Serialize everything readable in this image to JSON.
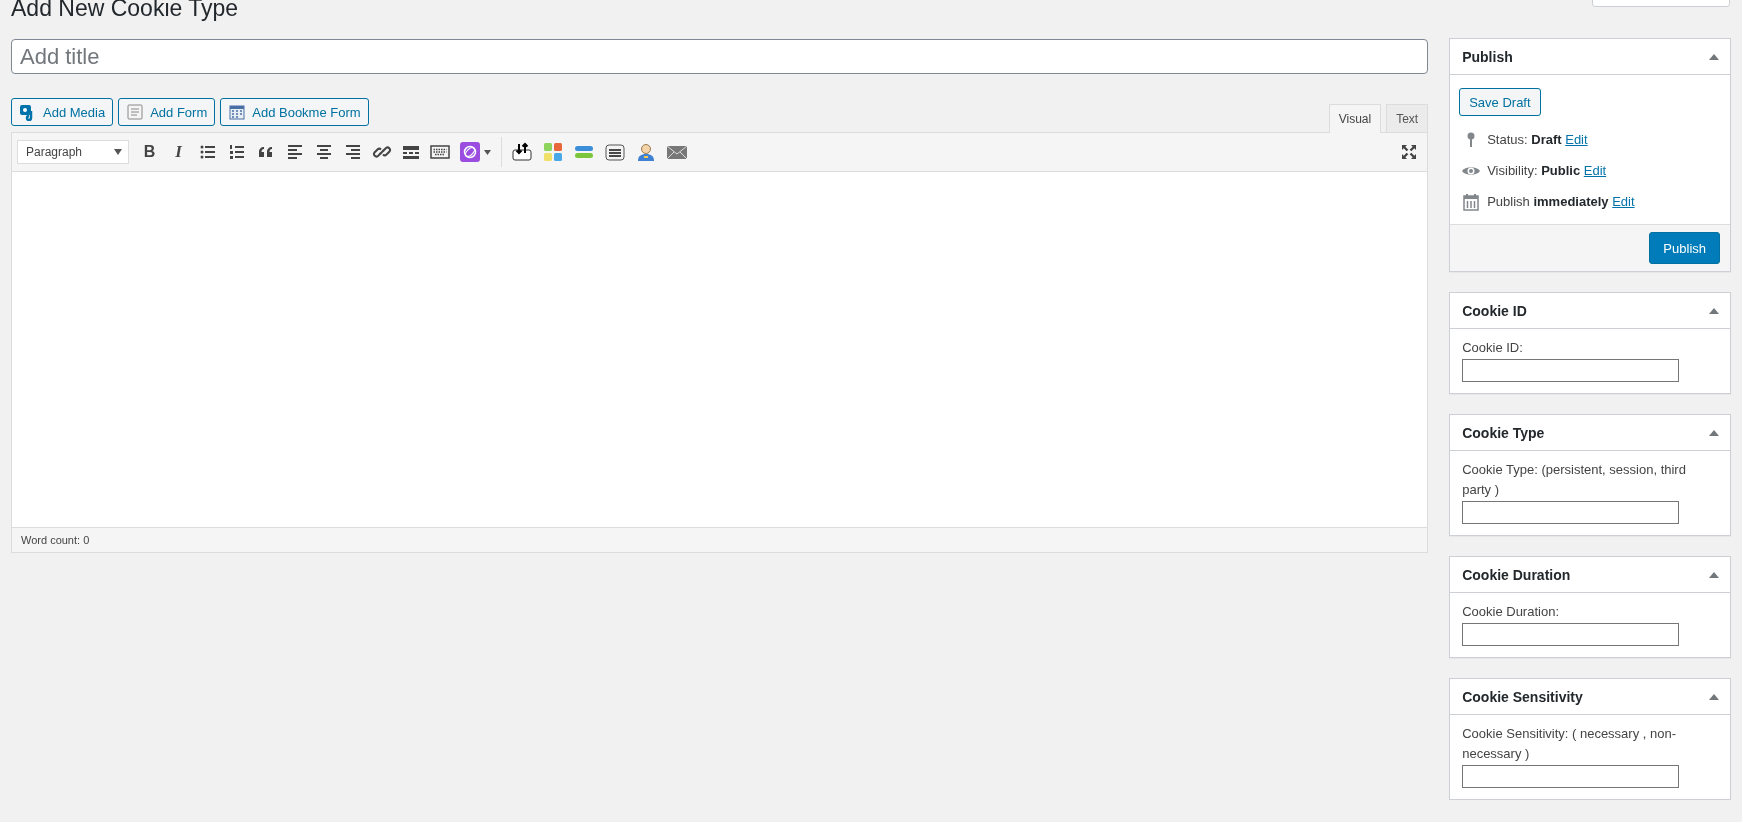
{
  "heading": "Add New Cookie Type",
  "title_field": {
    "placeholder": "Add title"
  },
  "media_buttons": [
    {
      "kind": "media",
      "label": "Add Media"
    },
    {
      "kind": "form",
      "label": "Add Form"
    },
    {
      "kind": "calendar",
      "label": "Add Bookme Form"
    }
  ],
  "editor_tabs": [
    {
      "label": "Visual",
      "selected": true
    },
    {
      "label": "Text",
      "selected": false
    }
  ],
  "toolbar": {
    "format_select": "Paragraph",
    "buttons": [
      {
        "kind": "bold",
        "label": "B"
      },
      {
        "kind": "italic",
        "label": "I"
      },
      {
        "kind": "bullet-list"
      },
      {
        "kind": "numbered-list"
      },
      {
        "kind": "blockquote"
      },
      {
        "kind": "align-left"
      },
      {
        "kind": "align-center"
      },
      {
        "kind": "align-right"
      },
      {
        "kind": "link"
      },
      {
        "kind": "read-more"
      },
      {
        "kind": "keyboard"
      },
      {
        "kind": "plugin-menu"
      },
      {
        "kind": "separator"
      },
      {
        "kind": "import"
      },
      {
        "kind": "tiles"
      },
      {
        "kind": "bars"
      },
      {
        "kind": "list-card"
      },
      {
        "kind": "person"
      },
      {
        "kind": "envelope"
      },
      {
        "kind": "fullscreen"
      }
    ]
  },
  "status_bar": "Word count: 0",
  "publish_box": {
    "title": "Publish",
    "expanded": true,
    "save_button": "Save Draft",
    "rows": [
      {
        "kind": "status",
        "text": "Status: **Draft**",
        "link": "Edit"
      },
      {
        "kind": "visibility",
        "text": "Visibility: **Public**",
        "link": "Edit"
      },
      {
        "kind": "schedule",
        "text": "Publish **immediately**",
        "link": "Edit"
      }
    ],
    "publish_button": "Publish"
  },
  "meta_boxes": [
    {
      "title": "Cookie ID",
      "expanded": true,
      "field_label": "Cookie ID:"
    },
    {
      "title": "Cookie Type",
      "expanded": true,
      "field_label": "Cookie Type: (persistent, session, third party )"
    },
    {
      "title": "Cookie Duration",
      "expanded": true,
      "field_label": "Cookie Duration:"
    },
    {
      "title": "Cookie Sensitivity",
      "expanded": true,
      "field_label": "Cookie Sensitivity: ( necessary , non-necessary )"
    }
  ]
}
